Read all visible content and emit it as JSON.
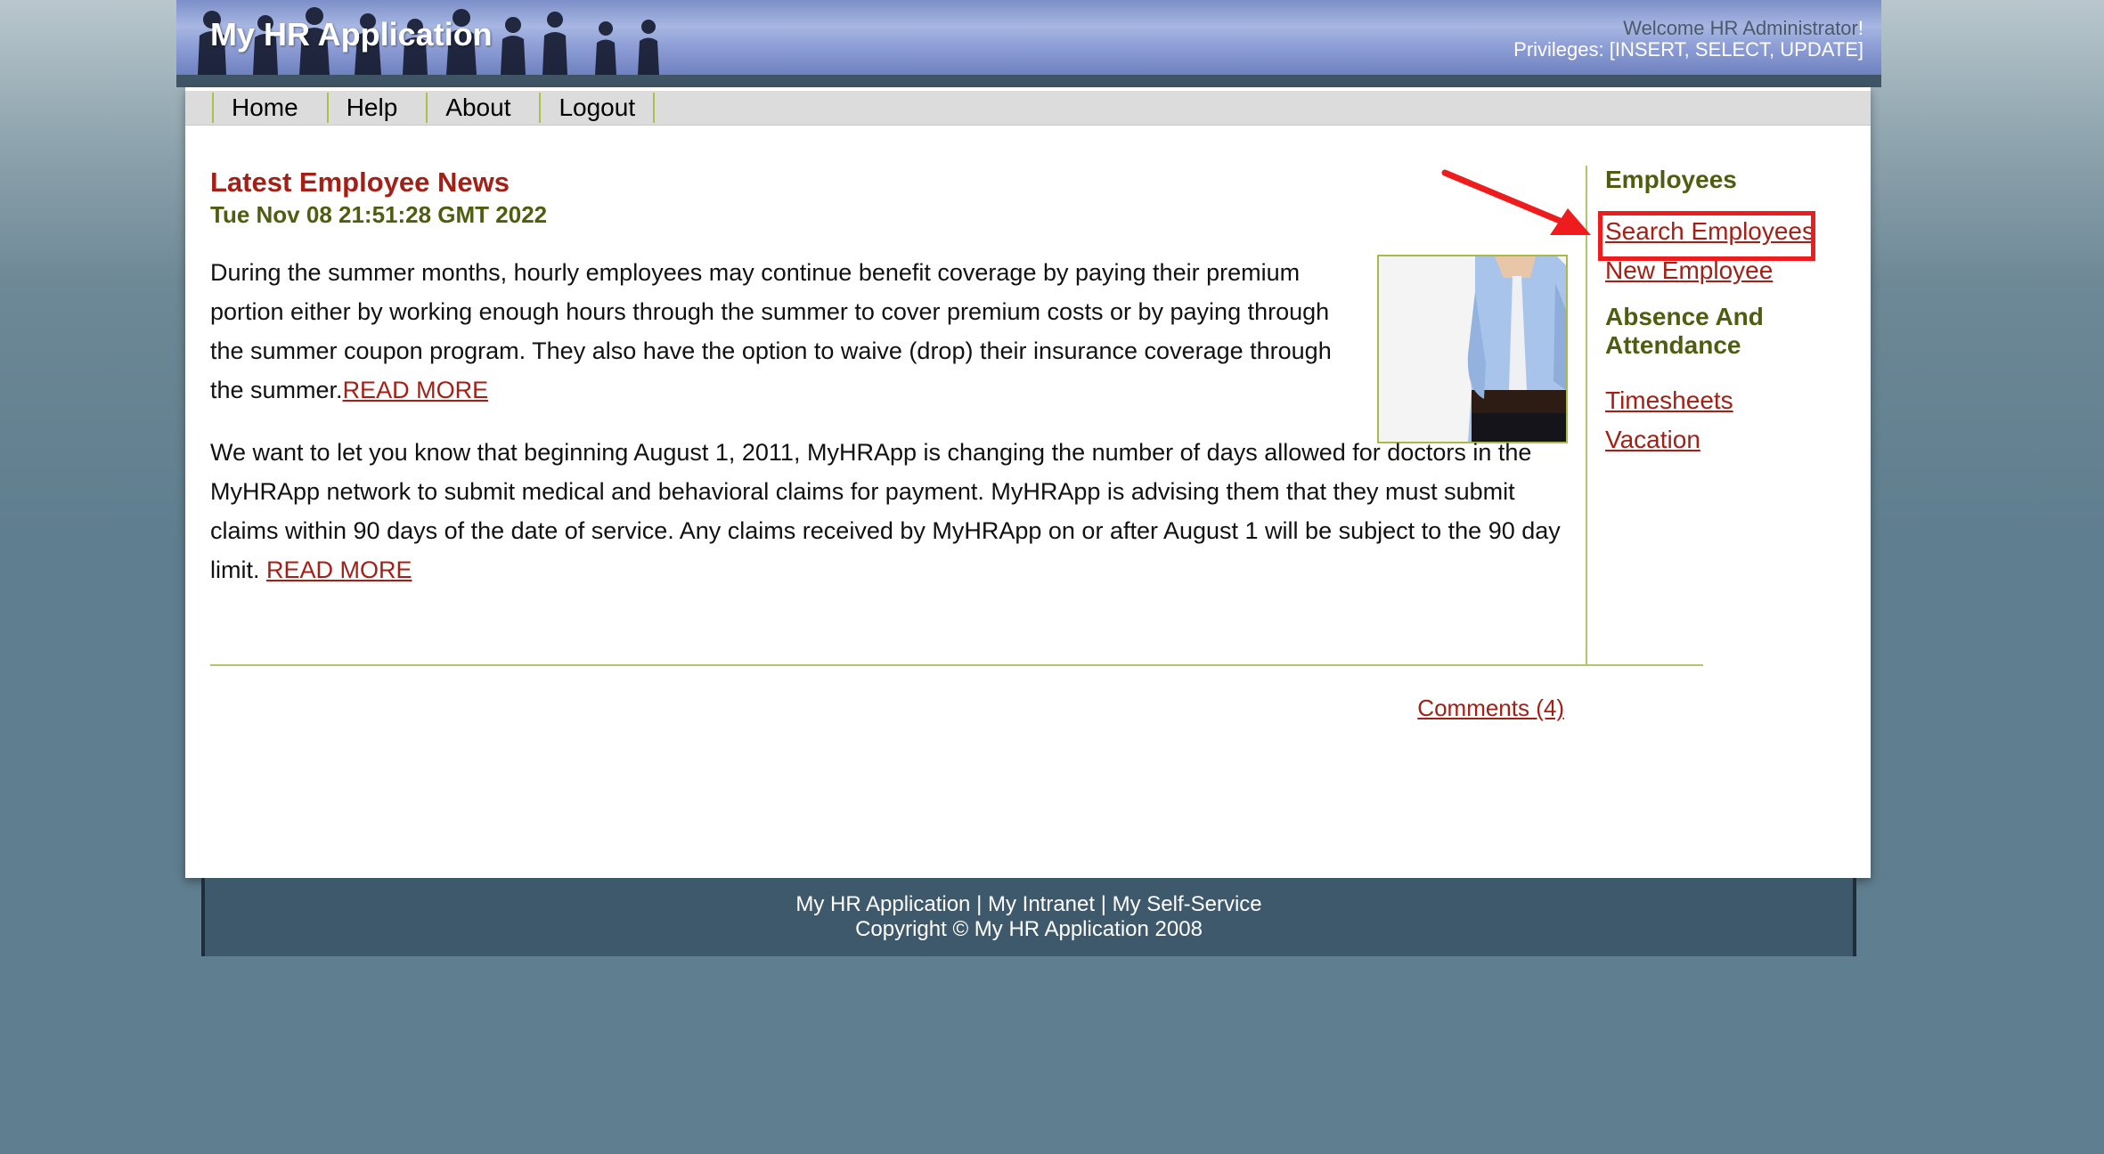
{
  "header": {
    "app_title": "My HR Application",
    "welcome": "Welcome HR Administrator",
    "privileges": "Privileges: [INSERT, SELECT, UPDATE]"
  },
  "nav": {
    "items": [
      "Home",
      "Help",
      "About",
      "Logout"
    ]
  },
  "news": {
    "title": "Latest Employee News",
    "date": "Tue Nov 08 21:51:28 GMT 2022",
    "para1": "During the summer months, hourly employees may continue benefit coverage by paying their premium portion either by working enough hours through the summer to cover premium costs or by paying through the summer coupon program. They also have the option to waive (drop) their insurance coverage through the summer.",
    "para1_link": "READ MORE",
    "para2": "We want to let you know that beginning August 1, 2011, MyHRApp is changing the number of days allowed for doctors in the MyHRApp network to submit medical and behavioral claims for payment.  MyHRApp is advising them that they must submit claims within 90 days of the date of service.  Any claims received by MyHRApp on or after August 1 will be subject to the 90 day limit. ",
    "para2_link": "READ MORE",
    "comments": "Comments (4)"
  },
  "sidebar": {
    "employees_heading": "Employees",
    "search_employees": "Search Employees",
    "new_employee": "New Employee",
    "absence_heading": "Absence And Attendance",
    "timesheets": "Timesheets",
    "vacation": "Vacation"
  },
  "footer": {
    "link1": "My HR Application",
    "link2": "My Intranet",
    "link3": "My Self-Service",
    "separator": " | ",
    "copyright": "Copyright © My HR Application 2008"
  },
  "colors": {
    "accent_red": "#a32016",
    "heading_olive": "#4f5d10",
    "annotation_red": "#ee1c1c"
  }
}
